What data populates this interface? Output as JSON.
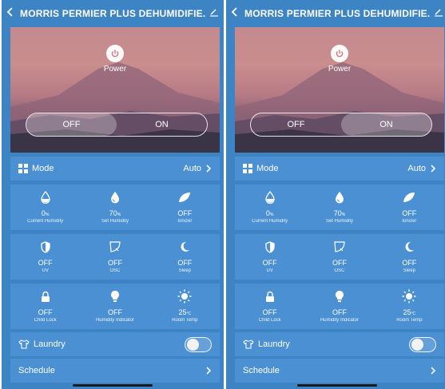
{
  "header": {
    "title": "MORRIS PERMIER PLUS DEHUMIDIFIE...",
    "back_icon": "chevron-left-icon",
    "edit_icon": "pencil-icon"
  },
  "power": {
    "label": "Power",
    "icon": "power-icon"
  },
  "toggle": {
    "off_label": "OFF",
    "on_label": "ON"
  },
  "mode_row": {
    "label": "Mode",
    "value": "Auto",
    "icon": "grid-icon"
  },
  "grid1": [
    {
      "value": "0",
      "unit": "%",
      "name": "Current Humidity",
      "icon": "droplet-outline-icon"
    },
    {
      "value": "70",
      "unit": "%",
      "name": "Set Humidity",
      "icon": "droplet-filled-icon"
    },
    {
      "value": "OFF",
      "unit": "",
      "name": "Ionizer",
      "icon": "leaf-icon"
    }
  ],
  "grid2": [
    {
      "value": "OFF",
      "unit": "",
      "name": "UV",
      "icon": "shield-icon"
    },
    {
      "value": "OFF",
      "unit": "",
      "name": "OSC",
      "icon": "swing-icon"
    },
    {
      "value": "OFF",
      "unit": "",
      "name": "Sleep",
      "icon": "moon-icon"
    }
  ],
  "grid3": [
    {
      "value": "OFF",
      "unit": "",
      "name": "Child Lock",
      "icon": "lock-icon"
    },
    {
      "value": "OFF",
      "unit": "",
      "name": "Humidity Indicator",
      "icon": "bulb-icon"
    },
    {
      "value": "25",
      "unit": "°C",
      "name": "Room Temp",
      "icon": "sun-icon"
    }
  ],
  "laundry_row": {
    "label": "Laundry",
    "icon": "shirt-icon",
    "switch_on": false
  },
  "schedule_row": {
    "label": "Schedule"
  },
  "screens": [
    {
      "id": "left",
      "active_toggle": "off"
    },
    {
      "id": "right",
      "active_toggle": "on"
    }
  ],
  "colors": {
    "background": "#3d84c4",
    "card": "#4a90d2",
    "text": "#ffffff"
  }
}
